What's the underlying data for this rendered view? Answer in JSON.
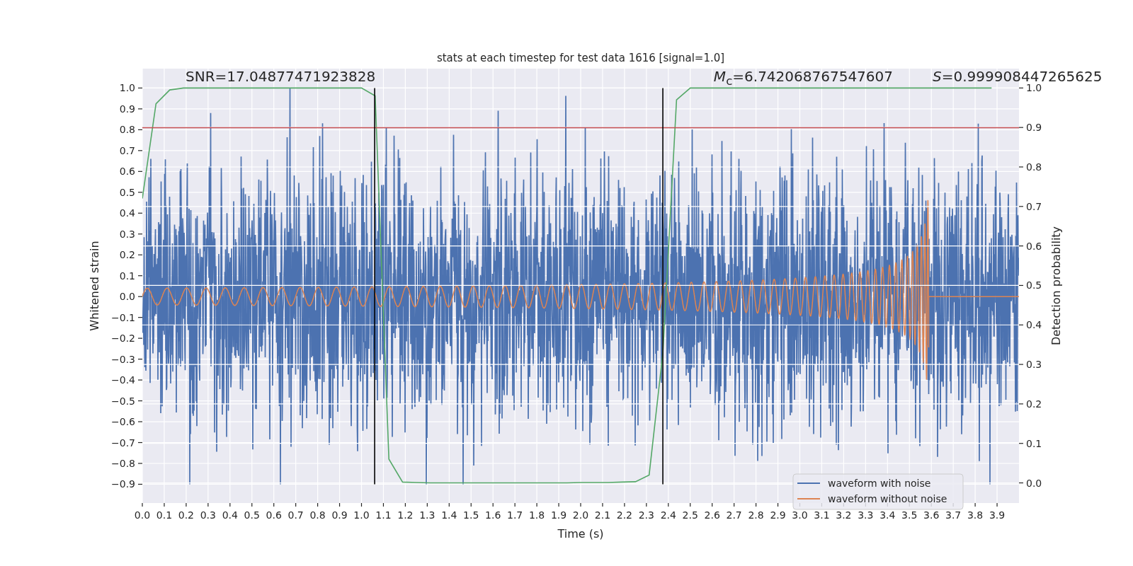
{
  "chart": {
    "chart_data": {
      "type": "line",
      "title": "stats at each timestep for test data 1616 [signal=1.0]",
      "xlabel": "Time (s)",
      "ylabel": "Whitened strain",
      "y2label": "Detection probability",
      "xlim": [
        0,
        4.0
      ],
      "ylim": [
        -0.99,
        1.093
      ],
      "y2lim": [
        -0.051,
        1.049
      ],
      "xticks": [
        {
          "value": 0,
          "label": "0.0"
        },
        {
          "value": 0.1,
          "label": "0.1"
        },
        {
          "value": 0.2,
          "label": "0.2"
        },
        {
          "value": 0.3,
          "label": "0.3"
        },
        {
          "value": 0.4,
          "label": "0.4"
        },
        {
          "value": 0.5,
          "label": "0.5"
        },
        {
          "value": 0.6,
          "label": "0.6"
        },
        {
          "value": 0.7,
          "label": "0.7"
        },
        {
          "value": 0.8,
          "label": "0.8"
        },
        {
          "value": 0.9,
          "label": "0.9"
        },
        {
          "value": 1.0,
          "label": "1.0"
        },
        {
          "value": 1.1,
          "label": "1.1"
        },
        {
          "value": 1.2,
          "label": "1.2"
        },
        {
          "value": 1.3,
          "label": "1.3"
        },
        {
          "value": 1.4,
          "label": "1.4"
        },
        {
          "value": 1.5,
          "label": "1.5"
        },
        {
          "value": 1.6,
          "label": "1.6"
        },
        {
          "value": 1.7,
          "label": "1.7"
        },
        {
          "value": 1.8,
          "label": "1.8"
        },
        {
          "value": 1.9,
          "label": "1.9"
        },
        {
          "value": 2.0,
          "label": "2.0"
        },
        {
          "value": 2.1,
          "label": "2.1"
        },
        {
          "value": 2.2,
          "label": "2.2"
        },
        {
          "value": 2.3,
          "label": "2.3"
        },
        {
          "value": 2.4,
          "label": "2.4"
        },
        {
          "value": 2.5,
          "label": "2.5"
        },
        {
          "value": 2.6,
          "label": "2.6"
        },
        {
          "value": 2.7,
          "label": "2.7"
        },
        {
          "value": 2.8,
          "label": "2.8"
        },
        {
          "value": 2.9,
          "label": "2.9"
        },
        {
          "value": 3.0,
          "label": "3.0"
        },
        {
          "value": 3.1,
          "label": "3.1"
        },
        {
          "value": 3.2,
          "label": "3.2"
        },
        {
          "value": 3.3,
          "label": "3.3"
        },
        {
          "value": 3.4,
          "label": "3.4"
        },
        {
          "value": 3.5,
          "label": "3.5"
        },
        {
          "value": 3.6,
          "label": "3.6"
        },
        {
          "value": 3.7,
          "label": "3.7"
        },
        {
          "value": 3.8,
          "label": "3.8"
        },
        {
          "value": 3.9,
          "label": "3.9"
        }
      ],
      "yticks": [
        {
          "value": 1.0,
          "label": "1.0"
        },
        {
          "value": 0.9,
          "label": "0.9"
        },
        {
          "value": 0.8,
          "label": "0.8"
        },
        {
          "value": 0.7,
          "label": "0.7"
        },
        {
          "value": 0.6,
          "label": "0.6"
        },
        {
          "value": 0.5,
          "label": "0.5"
        },
        {
          "value": 0.4,
          "label": "0.4"
        },
        {
          "value": 0.3,
          "label": "0.3"
        },
        {
          "value": 0.2,
          "label": "0.2"
        },
        {
          "value": 0.1,
          "label": "0.1"
        },
        {
          "value": 0.0,
          "label": "0.0"
        },
        {
          "value": -0.1,
          "label": "−0.1"
        },
        {
          "value": -0.2,
          "label": "−0.2"
        },
        {
          "value": -0.3,
          "label": "−0.3"
        },
        {
          "value": -0.4,
          "label": "−0.4"
        },
        {
          "value": -0.5,
          "label": "−0.5"
        },
        {
          "value": -0.6,
          "label": "−0.6"
        },
        {
          "value": -0.7,
          "label": "−0.7"
        },
        {
          "value": -0.8,
          "label": "−0.8"
        },
        {
          "value": -0.9,
          "label": "−0.9"
        }
      ],
      "y2ticks": [
        {
          "value": 1.0,
          "label": "1.0"
        },
        {
          "value": 0.9,
          "label": "0.9"
        },
        {
          "value": 0.8,
          "label": "0.8"
        },
        {
          "value": 0.7,
          "label": "0.7"
        },
        {
          "value": 0.6,
          "label": "0.6"
        },
        {
          "value": 0.5,
          "label": "0.5"
        },
        {
          "value": 0.4,
          "label": "0.4"
        },
        {
          "value": 0.3,
          "label": "0.3"
        },
        {
          "value": 0.2,
          "label": "0.2"
        },
        {
          "value": 0.1,
          "label": "0.1"
        },
        {
          "value": 0.0,
          "label": "0.0"
        }
      ],
      "x": [
        0,
        0.0625,
        0.125,
        0.1875,
        0.25,
        0.3125,
        0.375,
        0.4375,
        0.5,
        0.5625,
        0.625,
        0.6875,
        0.75,
        0.8125,
        0.875,
        0.9375,
        1.0,
        1.0625,
        1.125,
        1.1875,
        1.25,
        1.3125,
        1.375,
        1.4375,
        1.5,
        1.5625,
        1.625,
        1.6875,
        1.75,
        1.8125,
        1.875,
        1.9375,
        2.0,
        2.0625,
        2.125,
        2.1875,
        2.25,
        2.3125,
        2.375,
        2.4375,
        2.5,
        2.5625,
        2.625,
        2.6875,
        2.75,
        2.8125,
        2.875,
        2.9375,
        3.0,
        3.0625,
        3.125,
        3.1875,
        3.25,
        3.3125,
        3.375,
        3.4375,
        3.5,
        3.5625,
        3.625,
        3.6875,
        3.75,
        3.8125,
        3.875
      ],
      "series": [
        {
          "axis": "y2",
          "color": "#55a868",
          "values": [
            0.72,
            0.96,
            0.995,
            1.0,
            1.0,
            1.0,
            1.0,
            1.0,
            1.0,
            1.0,
            1.0,
            1.0,
            1.0,
            1.0,
            1.0,
            1.0,
            1.0,
            0.98,
            0.06,
            0.002,
            0.001,
            0.0,
            0.0,
            0.0,
            0.0,
            0.0,
            0.0,
            0.0,
            0.0,
            0.0,
            0.0,
            0.0,
            0.001,
            0.001,
            0.001,
            0.002,
            0.003,
            0.02,
            0.33,
            0.97,
            1.0,
            1.0,
            1.0,
            1.0,
            1.0,
            1.0,
            1.0,
            1.0,
            1.0,
            1.0,
            1.0,
            1.0,
            1.0,
            1.0,
            1.0,
            1.0,
            1.0,
            1.0,
            1.0,
            1.0,
            1.0,
            1.0,
            1.0
          ]
        }
      ],
      "ref_lines": [
        {
          "axis": "y",
          "value": 0.81,
          "color": "#c44e52"
        },
        {
          "axis": "x",
          "value": 1.06,
          "color": "#000000"
        },
        {
          "axis": "x",
          "value": 2.375,
          "color": "#000000"
        }
      ],
      "grid": true,
      "annotations": [
        {
          "x": 0.197,
          "y": 1.0,
          "text": "SNR=17.04877471923828"
        },
        {
          "x": 2.607,
          "y": 1.0,
          "text": "*M*$_{c}$=6.742068767547607"
        },
        {
          "x": 3.606,
          "y": 1.0,
          "text": "*S*=0.999908447265625"
        }
      ]
    },
    "legend": [
      {
        "label": "waveform with noise",
        "color": "#4c72b0"
      },
      {
        "label": "waveform without noise",
        "color": "#dd8452"
      }
    ]
  }
}
